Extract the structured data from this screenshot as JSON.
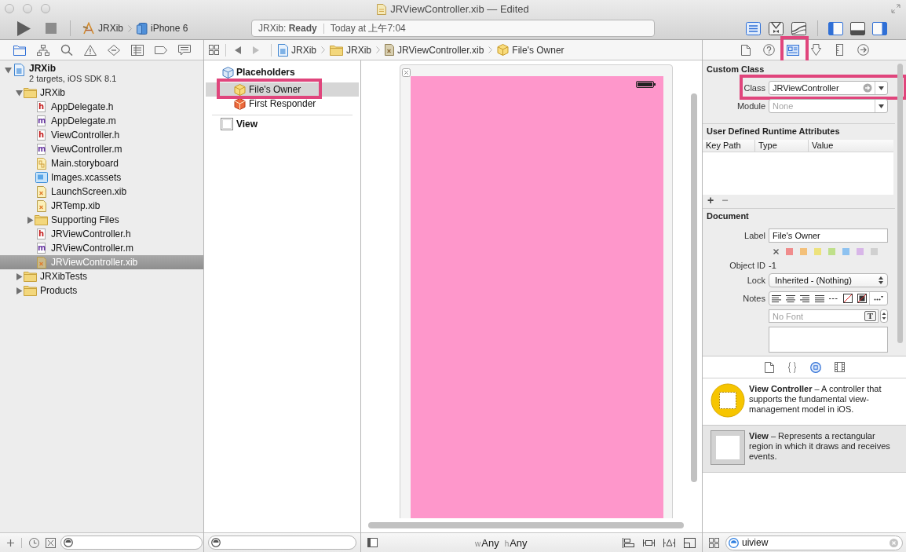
{
  "window": {
    "title": "JRViewController.xib — Edited"
  },
  "toolbar": {
    "scheme": "JRXib",
    "device": "iPhone 6",
    "activity": {
      "status": "JRXib: **Ready**",
      "time": "Today at 上午7:04"
    },
    "editor_modes": [
      {
        "kind": "standard",
        "selected": true
      },
      {
        "kind": "assistant",
        "selected": false
      },
      {
        "kind": "version",
        "selected": false
      }
    ],
    "panels": [
      {
        "kind": "navigator",
        "on": true
      },
      {
        "kind": "debug",
        "on": false
      },
      {
        "kind": "utilities",
        "on": true
      }
    ]
  },
  "navigator": {
    "tabs": [
      {
        "kind": "project",
        "selected": true
      },
      {
        "kind": "symbol",
        "selected": false
      },
      {
        "kind": "find",
        "selected": false
      },
      {
        "kind": "issue",
        "selected": false
      },
      {
        "kind": "test",
        "selected": false
      },
      {
        "kind": "debug",
        "selected": false
      },
      {
        "kind": "breakpoint",
        "selected": false
      },
      {
        "kind": "report",
        "selected": false
      }
    ],
    "tree": [
      {
        "kind": "project",
        "label": "JRXib",
        "detail": "2 targets, iOS SDK 8.1",
        "expanded": true,
        "selected": false,
        "children": [
          {
            "kind": "folder",
            "label": "JRXib",
            "expanded": true,
            "selected": false,
            "children": [
              {
                "kind": "header",
                "badge": "h",
                "label": "AppDelegate.h",
                "selected": false
              },
              {
                "kind": "source",
                "badge": "m",
                "label": "AppDelegate.m",
                "selected": false
              },
              {
                "kind": "header",
                "badge": "h",
                "label": "ViewController.h",
                "selected": false
              },
              {
                "kind": "source",
                "badge": "m",
                "label": "ViewController.m",
                "selected": false
              },
              {
                "kind": "storyboard",
                "label": "Main.storyboard",
                "selected": false
              },
              {
                "kind": "assets",
                "label": "Images.xcassets",
                "selected": false
              },
              {
                "kind": "xib",
                "label": "LaunchScreen.xib",
                "selected": false
              },
              {
                "kind": "xib",
                "label": "JRTemp.xib",
                "selected": false
              },
              {
                "kind": "folder",
                "label": "Supporting Files",
                "expanded": false,
                "selected": false
              },
              {
                "kind": "header",
                "badge": "h",
                "label": "JRViewController.h",
                "selected": false
              },
              {
                "kind": "source",
                "badge": "m",
                "label": "JRViewController.m",
                "selected": false
              },
              {
                "kind": "xib",
                "label": "JRViewController.xib",
                "selected": true
              }
            ]
          },
          {
            "kind": "folder",
            "label": "JRXibTests",
            "expanded": false,
            "selected": false
          },
          {
            "kind": "folder",
            "label": "Products",
            "expanded": false,
            "selected": false
          }
        ]
      }
    ]
  },
  "jump_bar": {
    "crumbs": [
      {
        "kind": "project",
        "label": "JRXib"
      },
      {
        "kind": "folder",
        "label": "JRXib"
      },
      {
        "kind": "xib",
        "label": "JRViewController.xib"
      },
      {
        "kind": "placeholder",
        "label": "File's Owner"
      }
    ]
  },
  "outline": {
    "placeholders": {
      "label": "Placeholders",
      "items": [
        {
          "kind": "owner",
          "label": "File's Owner",
          "selected": true,
          "highlighted": true
        },
        {
          "kind": "responder",
          "label": "First Responder",
          "selected": false,
          "highlighted": false
        }
      ]
    },
    "objects": [
      {
        "kind": "view",
        "label": "View",
        "selected": false
      }
    ]
  },
  "canvas": {
    "size_classes": [
      {
        "axis": "w",
        "value": "Any"
      },
      {
        "axis": "h",
        "value": "Any"
      }
    ]
  },
  "inspector": {
    "tabs": [
      {
        "kind": "file",
        "selected": false,
        "highlighted": false
      },
      {
        "kind": "help",
        "selected": false,
        "highlighted": false
      },
      {
        "kind": "identity",
        "selected": true,
        "highlighted": true
      },
      {
        "kind": "attributes",
        "selected": false,
        "highlighted": false
      },
      {
        "kind": "size",
        "selected": false,
        "highlighted": false
      },
      {
        "kind": "connections",
        "selected": false,
        "highlighted": false
      }
    ],
    "custom_class": {
      "title": "Custom Class",
      "class": {
        "label": "Class",
        "value": "JRViewController",
        "highlighted": true
      },
      "module": {
        "label": "Module",
        "placeholder": "None"
      }
    },
    "runtime_attributes": {
      "title": "User Defined Runtime Attributes",
      "columns": [
        "Key Path",
        "Type",
        "Value"
      ],
      "buttons": [
        "+",
        "−"
      ]
    },
    "document": {
      "title": "Document",
      "label": {
        "label": "Label",
        "value": "File's Owner"
      },
      "colors": [
        {
          "color": "#f08c8c"
        },
        {
          "color": "#f3c07a"
        },
        {
          "color": "#ede27c"
        },
        {
          "color": "#bfe08a"
        },
        {
          "color": "#8ec2f0"
        },
        {
          "color": "#d8b6e8"
        },
        {
          "color": "#d0d0d0"
        }
      ],
      "object_id": {
        "label": "Object ID",
        "value": "-1"
      },
      "lock": {
        "label": "Lock",
        "value": "Inherited - (Nothing)"
      },
      "notes": {
        "label": "Notes",
        "font": {
          "placeholder": "No Font",
          "button": "T"
        }
      }
    }
  },
  "library": {
    "tabs": [
      {
        "kind": "file_templates",
        "selected": false
      },
      {
        "kind": "code_snippets",
        "selected": false
      },
      {
        "kind": "objects",
        "selected": true
      },
      {
        "kind": "media",
        "selected": false
      }
    ],
    "items": [
      {
        "kind": "view_controller",
        "text": "**View Controller** – A controller that supports the fundamental view-management model in iOS.",
        "selected": false
      },
      {
        "kind": "view",
        "text": "**View** – Represents a rectangular region in which it draws and receives events.",
        "selected": true
      }
    ],
    "search": {
      "value": "uiview"
    }
  }
}
